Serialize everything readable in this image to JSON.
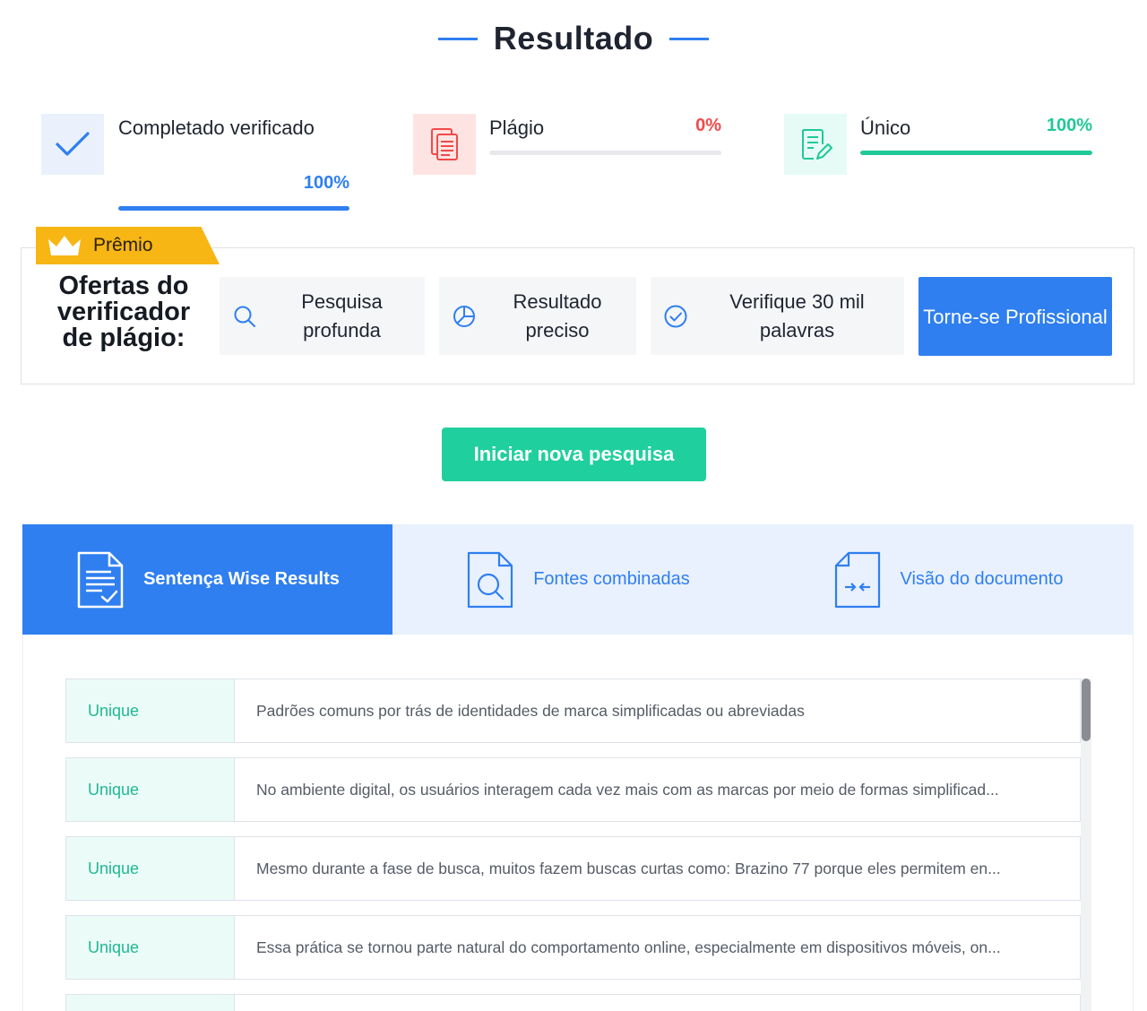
{
  "header": {
    "title": "Resultado"
  },
  "stats": [
    {
      "label": "Completado verificado",
      "value": "100%",
      "fraction": 1.0,
      "color": "#2f7ff0",
      "icon": "checkmark-icon"
    },
    {
      "label": "Plágio",
      "value": "0%",
      "fraction": 0.0,
      "color": "#f04a4a",
      "icon": "document-copy-icon"
    },
    {
      "label": "Único",
      "value": "100%",
      "fraction": 1.0,
      "color": "#20c997",
      "icon": "edit-document-icon"
    }
  ],
  "premium": {
    "tag": "Prêmio",
    "offers_title": "Ofertas do verificador de plágio:",
    "features": [
      {
        "label": "Pesquisa profunda",
        "icon": "search-icon"
      },
      {
        "label": "Resultado preciso",
        "icon": "pie-chart-icon"
      },
      {
        "label": "Verifique 30 mil palavras",
        "icon": "check-circle-icon"
      }
    ],
    "pro_button": "Torne-se Profissional"
  },
  "actions": {
    "new_search": "Iniciar nova pesquisa"
  },
  "tabs": [
    {
      "label": "Sentença Wise Results",
      "icon": "document-check-icon",
      "active": true
    },
    {
      "label": "Fontes combinadas",
      "icon": "document-search-icon",
      "active": false
    },
    {
      "label": "Visão do documento",
      "icon": "document-compare-icon",
      "active": false
    }
  ],
  "results": [
    {
      "status": "Unique",
      "text": "Padrões comuns por trás de identidades de marca simplificadas ou abreviadas"
    },
    {
      "status": "Unique",
      "text": "No ambiente digital, os usuários interagem cada vez mais com as marcas por meio de formas simplificad..."
    },
    {
      "status": "Unique",
      "text": "Mesmo durante a fase de busca, muitos fazem buscas curtas como: Brazino 77 porque eles permitem en..."
    },
    {
      "status": "Unique",
      "text": "Essa prática se tornou parte natural do comportamento online, especialmente em dispositivos móveis, on..."
    }
  ],
  "colors": {
    "accent": "#2f7ff0",
    "success": "#20cf9e",
    "danger": "#f04a4a",
    "premium": "#f7b614"
  }
}
